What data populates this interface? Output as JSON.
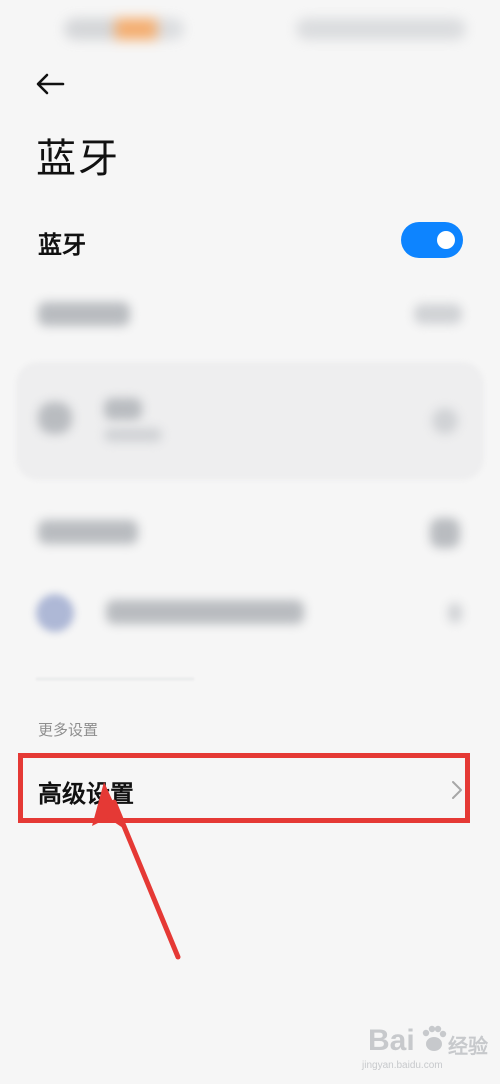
{
  "screen": {
    "title": "蓝牙",
    "bluetooth_row": {
      "label": "蓝牙",
      "toggle_on": true,
      "accent": "#0d84ff"
    },
    "more_settings": {
      "header": "更多设置",
      "advanced_label": "高级设置"
    }
  },
  "icons": {
    "back": "back-arrow-icon",
    "chevron": "chevron-right-icon"
  },
  "annotation": {
    "highlight_color": "#e53935"
  },
  "watermark": {
    "brand": "Bai",
    "suffix": "经验",
    "domain": "jingyan.baidu.com"
  }
}
